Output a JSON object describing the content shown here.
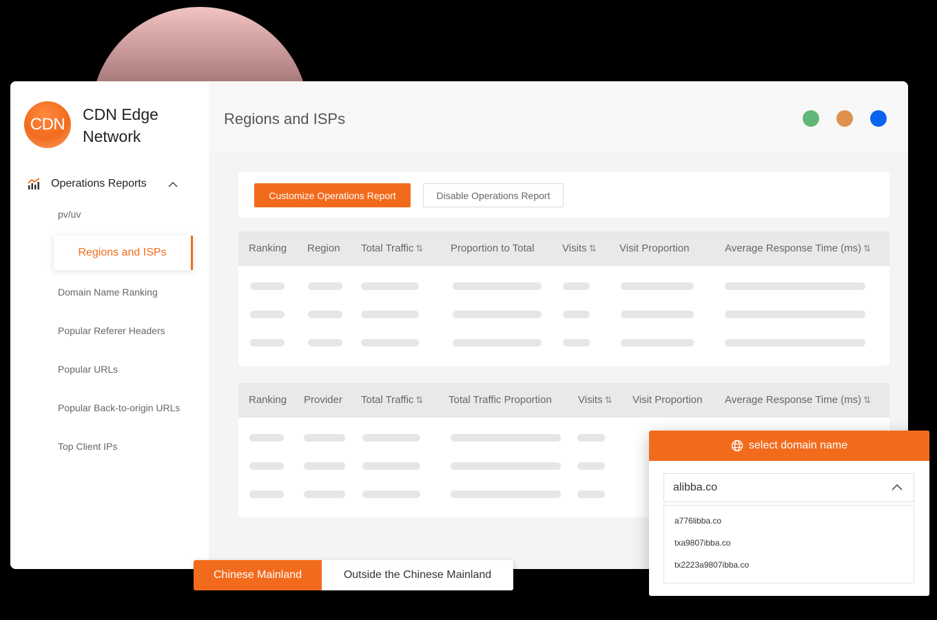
{
  "brand": {
    "logo_text": "CDN",
    "name_line1": "CDN Edge",
    "name_line2": "Network"
  },
  "sidebar": {
    "group_label": "Operations Reports",
    "items": [
      "pv/uv",
      "Regions and ISPs",
      "Domain Name Ranking",
      "Popular Referer Headers",
      "Popular URLs",
      "Popular Back-to-origin URLs",
      "Top Client IPs"
    ],
    "active_index": 1
  },
  "header": {
    "title": "Regions and ISPs",
    "status_colors": [
      "#5fb878",
      "#e0914f",
      "#0b64f0"
    ]
  },
  "toolbar": {
    "customize_label": "Customize Operations Report",
    "disable_label": "Disable Operations Report"
  },
  "region_table": {
    "columns": [
      "Ranking",
      "Region",
      "Total Traffic",
      "Proportion to Total",
      "Visits",
      "Visit Proportion",
      "Average Response Time (ms)"
    ],
    "sort_glyph": "⇅"
  },
  "isp_table": {
    "columns": [
      "Ranking",
      "Provider",
      "Total Traffic",
      "Total Traffic Proportion",
      "Visits",
      "Visit Proportion",
      "Average Response Time (ms)"
    ]
  },
  "domain_dropdown": {
    "header": "select domain name",
    "selected": "alibba.co",
    "options": [
      "a776libba.co",
      "txa9807ibba.co",
      "tx2223a9807ibba.co"
    ]
  },
  "region_tabs": {
    "active": "Chinese Mainland",
    "inactive": "Outside the Chinese Mainland"
  },
  "accent": "#f26b1d"
}
